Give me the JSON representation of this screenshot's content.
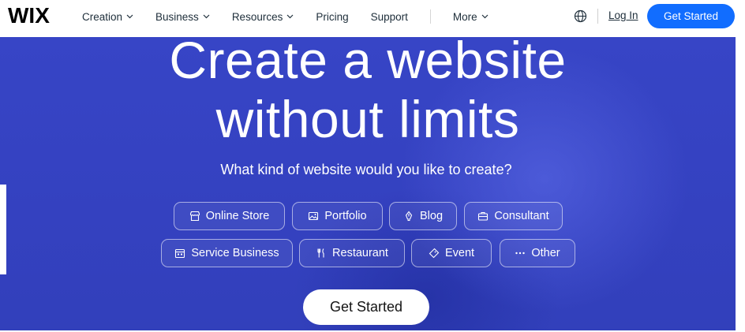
{
  "brand": {
    "logo": "WIX",
    "accent": "#116dff",
    "hero_bg": "#3441c0"
  },
  "nav": {
    "items": [
      {
        "label": "Creation",
        "has_dropdown": true
      },
      {
        "label": "Business",
        "has_dropdown": true
      },
      {
        "label": "Resources",
        "has_dropdown": true
      },
      {
        "label": "Pricing",
        "has_dropdown": false
      },
      {
        "label": "Support",
        "has_dropdown": false
      },
      {
        "label": "More",
        "has_dropdown": true
      }
    ],
    "language_icon": "globe-icon",
    "login_label": "Log In",
    "cta_label": "Get Started"
  },
  "hero": {
    "headline_line1": "Create a website",
    "headline_line2": "without limits",
    "subheading": "What kind of website would you like to create?",
    "categories": [
      {
        "label": "Online Store",
        "icon": "storefront-icon"
      },
      {
        "label": "Portfolio",
        "icon": "image-icon"
      },
      {
        "label": "Blog",
        "icon": "pen-nib-icon"
      },
      {
        "label": "Consultant",
        "icon": "briefcase-icon"
      },
      {
        "label": "Service Business",
        "icon": "calendar-icon"
      },
      {
        "label": "Restaurant",
        "icon": "fork-knife-icon"
      },
      {
        "label": "Event",
        "icon": "ticket-icon"
      },
      {
        "label": "Other",
        "icon": "more-dots-icon"
      }
    ],
    "cta_label": "Get Started"
  }
}
